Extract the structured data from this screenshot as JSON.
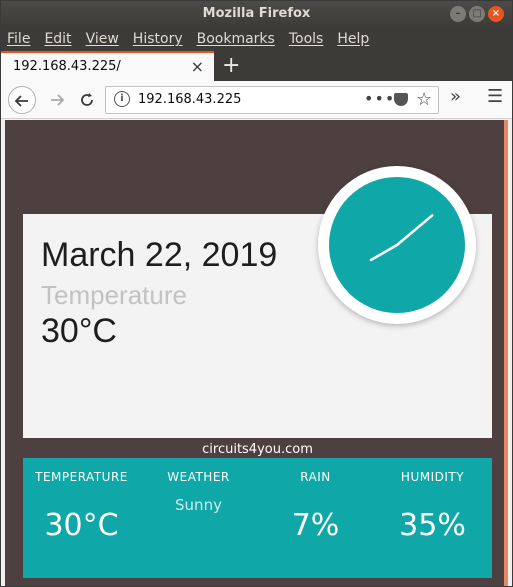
{
  "window": {
    "title": "Mozilla Firefox"
  },
  "menu": [
    "File",
    "Edit",
    "View",
    "History",
    "Bookmarks",
    "Tools",
    "Help"
  ],
  "tab": {
    "label": "192.168.43.225/",
    "close": "×",
    "new": "+"
  },
  "nav": {
    "url": "192.168.43.225"
  },
  "page": {
    "date": "March 22, 2019",
    "temp_label": "Temperature",
    "temp_value": "30°C",
    "site": "circuits4you.com",
    "clock": {
      "hour": 1,
      "minute": 40
    },
    "stats": [
      {
        "label": "TEMPERATURE",
        "sub": "",
        "value": "30°C"
      },
      {
        "label": "WEATHER",
        "sub": "Sunny",
        "value": ""
      },
      {
        "label": "RAIN",
        "sub": "",
        "value": "7%"
      },
      {
        "label": "HUMIDITY",
        "sub": "",
        "value": "35%"
      }
    ]
  },
  "colors": {
    "accent": "#0fa7a8",
    "background": "#4e4040",
    "tab_highlight": "#e95420"
  }
}
